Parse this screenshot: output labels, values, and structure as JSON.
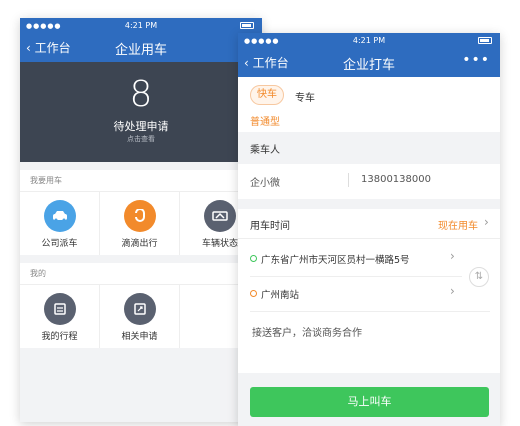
{
  "back_phone": {
    "status": {
      "signal": "●●●●●",
      "time": "4:21 PM"
    },
    "nav": {
      "back": "工作台",
      "title": "企业用车",
      "more": "•••"
    },
    "pending": {
      "count": "8",
      "label": "待处理申请",
      "hint": "点击查看"
    },
    "section1": {
      "title": "我要用车",
      "items": [
        {
          "label": "公司派车",
          "color": "#4aa3e6"
        },
        {
          "label": "滴滴出行",
          "color": "#f28a2b"
        },
        {
          "label": "车辆状态",
          "color": "#5a6170"
        }
      ]
    },
    "section2": {
      "title": "我的",
      "items": [
        {
          "label": "我的行程",
          "color": "#5a6170"
        },
        {
          "label": "相关申请",
          "color": "#5a6170"
        }
      ]
    }
  },
  "front_phone": {
    "status": {
      "signal": "●●●●●",
      "time": "4:21 PM"
    },
    "nav": {
      "back": "工作台",
      "title": "企业打车",
      "more": "•••"
    },
    "tabs": {
      "active": "快车",
      "other": "专车",
      "sub": "普通型"
    },
    "passenger_header": "乘车人",
    "passenger": {
      "name": "企小微",
      "phone": "13800138000"
    },
    "time": {
      "label": "用车时间",
      "value": "现在用车"
    },
    "route": {
      "from": "广东省广州市天河区员村一横路5号",
      "to": "广州南站"
    },
    "note": "接送客户，洽谈商务合作",
    "call_button": "马上叫车",
    "colors": {
      "accent": "#2e6cbf",
      "orange": "#f28a2b",
      "green": "#3ec65c"
    }
  }
}
